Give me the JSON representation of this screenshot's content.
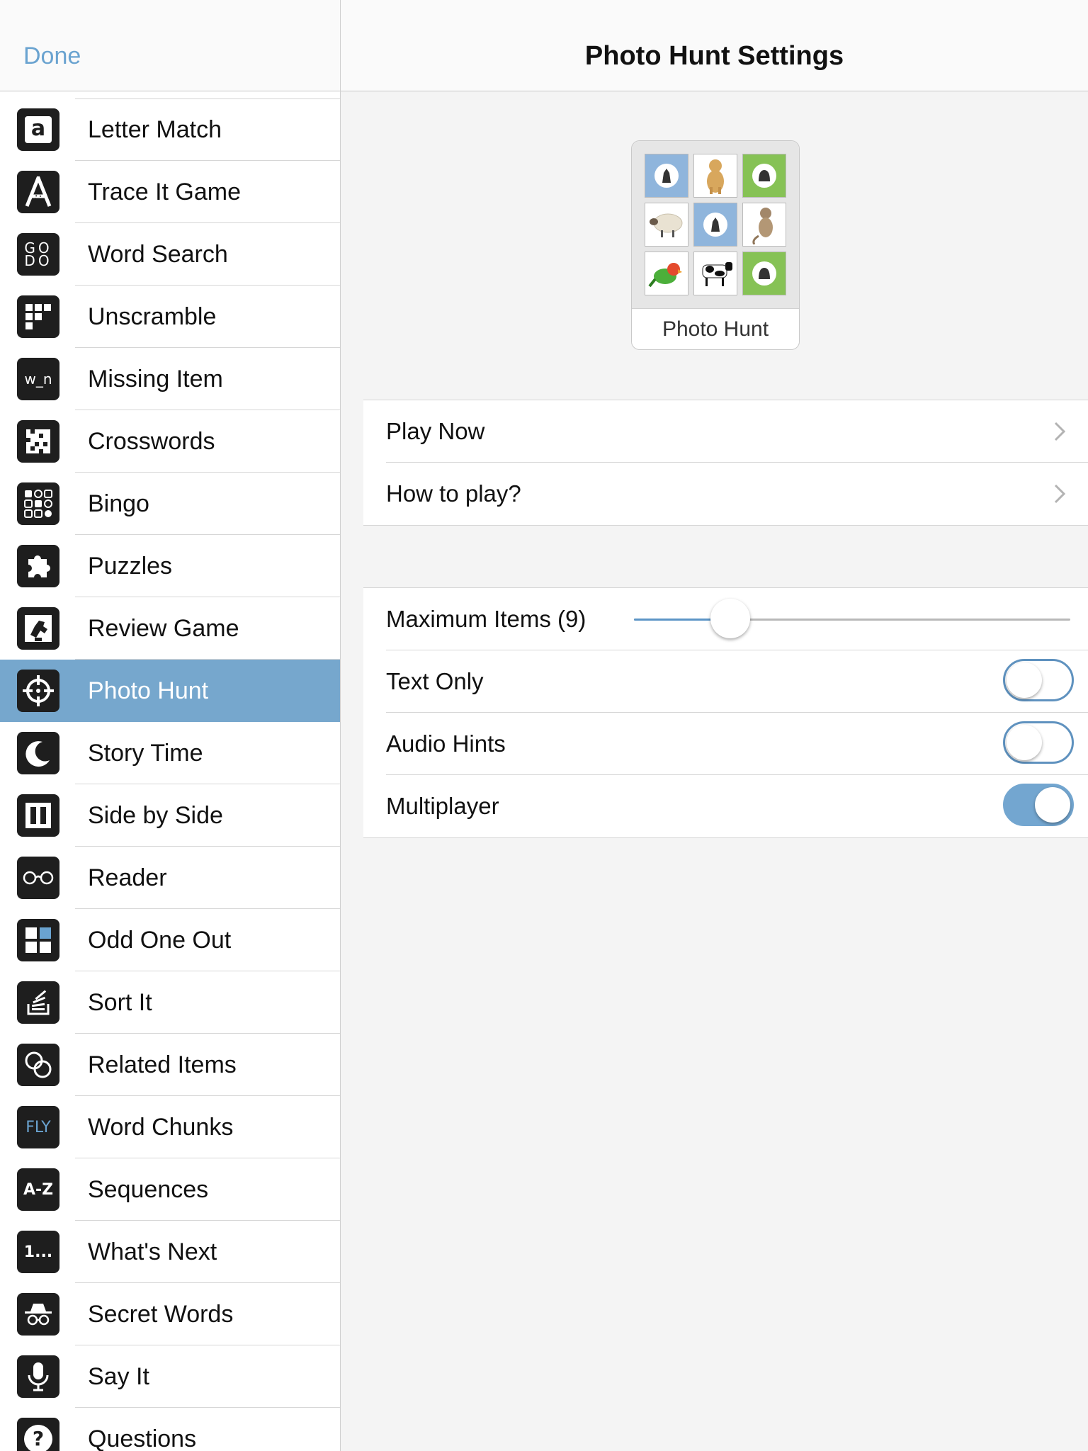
{
  "sidebar": {
    "done_label": "Done",
    "items": [
      {
        "label": "Letter Match",
        "icon": "letter-a-icon"
      },
      {
        "label": "Trace It Game",
        "icon": "trace-a-icon"
      },
      {
        "label": "Word Search",
        "icon": "word-search-icon"
      },
      {
        "label": "Unscramble",
        "icon": "unscramble-icon"
      },
      {
        "label": "Missing Item",
        "icon": "missing-letter-icon"
      },
      {
        "label": "Crosswords",
        "icon": "crossword-icon"
      },
      {
        "label": "Bingo",
        "icon": "bingo-icon"
      },
      {
        "label": "Puzzles",
        "icon": "puzzle-icon"
      },
      {
        "label": "Review Game",
        "icon": "review-icon"
      },
      {
        "label": "Photo Hunt",
        "icon": "crosshair-icon"
      },
      {
        "label": "Story Time",
        "icon": "moon-icon"
      },
      {
        "label": "Side by Side",
        "icon": "columns-icon"
      },
      {
        "label": "Reader",
        "icon": "glasses-icon"
      },
      {
        "label": "Odd One Out",
        "icon": "grid-icon"
      },
      {
        "label": "Sort It",
        "icon": "sort-icon"
      },
      {
        "label": "Related Items",
        "icon": "circles-icon"
      },
      {
        "label": "Word Chunks",
        "icon": "fly-icon"
      },
      {
        "label": "Sequences",
        "icon": "a-z-icon"
      },
      {
        "label": "What's Next",
        "icon": "ellipsis-icon"
      },
      {
        "label": "Secret Words",
        "icon": "spy-icon"
      },
      {
        "label": "Say It",
        "icon": "microphone-icon"
      },
      {
        "label": "Questions",
        "icon": "question-icon"
      }
    ],
    "icon_texts": {
      "letter_a": "a",
      "word_search": "GO DO",
      "missing_item": "w_n",
      "word_chunks": "FLY",
      "sequences": "A-Z",
      "whats_next": "1...",
      "questions": "?"
    },
    "selected_index": 9,
    "selected_color": "#76a7cd"
  },
  "main": {
    "title": "Photo Hunt Settings",
    "preview_label": "Photo Hunt",
    "nav_rows": [
      {
        "label": "Play Now"
      },
      {
        "label": "How to play?"
      }
    ],
    "settings": {
      "max_items_label": "Maximum Items (9)",
      "max_items_slider_fraction": 0.22,
      "text_only_label": "Text Only",
      "text_only_on": false,
      "audio_hints_label": "Audio Hints",
      "audio_hints_on": false,
      "multiplayer_label": "Multiplayer",
      "multiplayer_on": true
    },
    "accent_color": "#5f92bf"
  }
}
